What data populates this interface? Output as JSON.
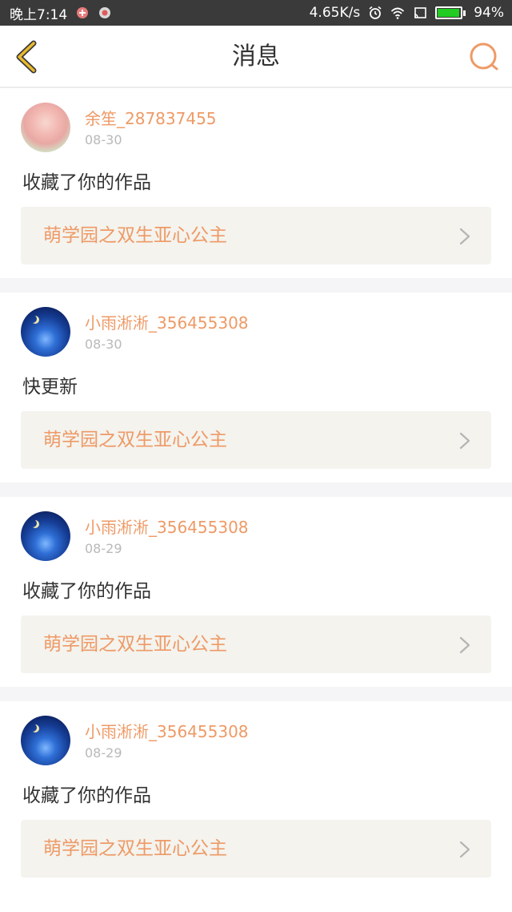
{
  "status_bar": {
    "time": "晚上7:14",
    "network_speed": "4.65K/s",
    "battery_percent": "94%",
    "battery_level": 0.94,
    "battery_color": "#22cc22",
    "icons": [
      "notification-icon",
      "notification-icon-2",
      "alarm-icon",
      "wifi-icon",
      "cast-icon",
      "battery-icon"
    ]
  },
  "header": {
    "title": "消息",
    "back_icon": "chevron-left-icon",
    "search_icon": "search-icon"
  },
  "colors": {
    "accent": "#ee9a66",
    "back_icon": "#e8b92e"
  },
  "messages": [
    {
      "avatar": "anime-girl",
      "sender": "余笙_287837455",
      "date": "08-30",
      "text": "收藏了你的作品",
      "work_title": "萌学园之双生亚心公主"
    },
    {
      "avatar": "night-sky",
      "sender": "小雨淅淅_356455308",
      "date": "08-30",
      "text": "快更新",
      "work_title": "萌学园之双生亚心公主"
    },
    {
      "avatar": "night-sky",
      "sender": "小雨淅淅_356455308",
      "date": "08-29",
      "text": "收藏了你的作品",
      "work_title": "萌学园之双生亚心公主"
    },
    {
      "avatar": "night-sky",
      "sender": "小雨淅淅_356455308",
      "date": "08-29",
      "text": "收藏了你的作品",
      "work_title": "萌学园之双生亚心公主"
    }
  ]
}
